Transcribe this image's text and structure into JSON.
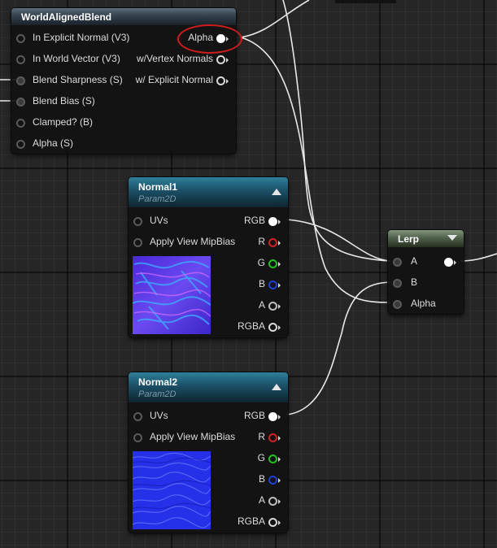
{
  "world_aligned_blend": {
    "title": "WorldAlignedBlend",
    "inputs": [
      "In Explicit Normal (V3)",
      "In World Vector (V3)",
      "Blend Sharpness (S)",
      "Blend Bias (S)",
      "Clamped? (B)",
      "Alpha (S)"
    ],
    "outputs": [
      "Alpha",
      "w/Vertex Normals",
      "w/ Explicit Normal"
    ]
  },
  "normal1": {
    "title": "Normal1",
    "subtitle": "Param2D",
    "inputs": [
      "UVs",
      "Apply View MipBias"
    ],
    "outputs": [
      "RGB",
      "R",
      "G",
      "B",
      "A",
      "RGBA"
    ]
  },
  "normal2": {
    "title": "Normal2",
    "subtitle": "Param2D",
    "inputs": [
      "UVs",
      "Apply View MipBias"
    ],
    "outputs": [
      "RGB",
      "R",
      "G",
      "B",
      "A",
      "RGBA"
    ]
  },
  "lerp": {
    "title": "Lerp",
    "inputs": [
      "A",
      "B",
      "Alpha"
    ]
  },
  "colors": {
    "pin_red": "#d42020",
    "pin_green": "#20c020",
    "pin_blue": "#2040d0",
    "highlight_ring": "#d01c1c",
    "wire": "#e8e8e8"
  }
}
